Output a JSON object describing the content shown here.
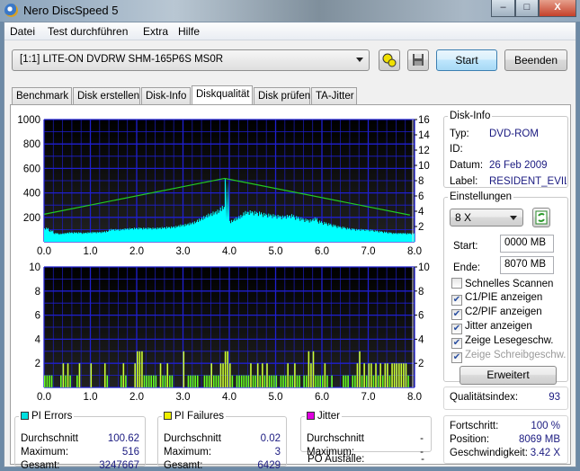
{
  "window": {
    "title": "Nero DiscSpeed 5",
    "minimize": "–",
    "maximize": "□",
    "close": "X"
  },
  "menu": [
    "Datei",
    "Test durchführen",
    "Extra",
    "Hilfe"
  ],
  "toolbar": {
    "drive": "[1:1]  LITE-ON DVDRW SHM-165P6S MS0R",
    "start": "Start",
    "exit": "Beenden"
  },
  "tabs": [
    "Benchmark",
    "Disk erstellen",
    "Disk-Info",
    "Diskqualität",
    "Disk prüfen",
    "TA-Jitter"
  ],
  "active_tab": "Diskqualität",
  "disk_info": {
    "title": "Disk-Info",
    "typ_label": "Typ:",
    "typ": "DVD-ROM",
    "id_label": "ID:",
    "datum_label": "Datum:",
    "datum": "26 Feb 2009",
    "label_label": "Label:",
    "label": "RESIDENT_EVIL"
  },
  "settings": {
    "title": "Einstellungen",
    "speed": "8 X",
    "start_label": "Start:",
    "start": "0000 MB",
    "end_label": "Ende:",
    "end": "8070 MB",
    "checkboxes": [
      {
        "label": "Schnelles Scannen",
        "checked": false,
        "enabled": true
      },
      {
        "label": "C1/PIE anzeigen",
        "checked": true,
        "enabled": true
      },
      {
        "label": "C2/PIF anzeigen",
        "checked": true,
        "enabled": true
      },
      {
        "label": "Jitter anzeigen",
        "checked": true,
        "enabled": true
      },
      {
        "label": "Zeige Lesegeschw.",
        "checked": true,
        "enabled": true
      },
      {
        "label": "Zeige Schreibgeschw.",
        "checked": true,
        "enabled": false
      }
    ],
    "advanced": "Erweitert"
  },
  "quality": {
    "label": "Qualitätsindex:",
    "value": "93"
  },
  "progress": {
    "progress_label": "Fortschritt:",
    "progress": "100 %",
    "position_label": "Position:",
    "position": "8069 MB",
    "speed_label": "Geschwindigkeit:",
    "speed": "3.42 X"
  },
  "stats": {
    "pi_errors": {
      "title": "PI Errors",
      "color": "#00e0e0",
      "avg_label": "Durchschnitt",
      "avg": "100.62",
      "max_label": "Maximum:",
      "max": "516",
      "total_label": "Gesamt:",
      "total": "3247667"
    },
    "pi_failures": {
      "title": "PI Failures",
      "color": "#f0f000",
      "avg_label": "Durchschnitt",
      "avg": "0.02",
      "max_label": "Maximum:",
      "max": "3",
      "total_label": "Gesamt:",
      "total": "6429"
    },
    "jitter": {
      "title": "Jitter",
      "color": "#e000e0",
      "avg_label": "Durchschnitt",
      "avg": "-",
      "max_label": "Maximum:",
      "max": "-",
      "po_label": "PO Ausfälle:",
      "po": "-"
    }
  },
  "chart_data": [
    {
      "type": "area",
      "title": "PI Errors",
      "x_range": [
        0,
        8
      ],
      "ylim": [
        0,
        1000
      ],
      "y2lim": [
        0,
        16
      ],
      "xticks": [
        "0.0",
        "1.0",
        "2.0",
        "3.0",
        "4.0",
        "5.0",
        "6.0",
        "7.0",
        "8.0"
      ],
      "yticks": [
        "1000",
        "800",
        "600",
        "400",
        "200"
      ],
      "y2ticks": [
        "16",
        "14",
        "12",
        "10",
        "8",
        "6",
        "4",
        "2"
      ],
      "pie_step": 0.1,
      "pie": [
        110,
        90,
        70,
        65,
        70,
        75,
        75,
        75,
        72,
        75,
        78,
        78,
        80,
        85,
        100,
        100,
        100,
        105,
        108,
        110,
        112,
        110,
        112,
        110,
        112,
        115,
        118,
        120,
        125,
        135,
        140,
        150,
        160,
        180,
        200,
        220,
        235,
        250,
        280,
        516,
        170,
        190,
        210,
        240,
        245,
        240,
        235,
        225,
        220,
        215,
        210,
        205,
        210,
        215,
        200,
        190,
        180,
        175,
        190,
        165,
        155,
        145,
        135,
        125,
        118,
        110,
        105,
        100,
        100,
        98,
        95,
        90,
        85,
        80,
        75,
        70,
        70,
        70,
        68,
        68
      ],
      "read_speed": [
        [
          0,
          3.6
        ],
        [
          3.9,
          8.3
        ],
        [
          7.9,
          3.5
        ]
      ],
      "colors": {
        "pie": "#00ffff",
        "speed": "#22cc22",
        "grid": "#1f1fd0"
      }
    },
    {
      "type": "bar",
      "title": "PI Failures",
      "x_range": [
        0,
        8
      ],
      "ylim": [
        0,
        10
      ],
      "xticks": [
        "0.0",
        "1.0",
        "2.0",
        "3.0",
        "4.0",
        "5.0",
        "6.0",
        "7.0",
        "8.0"
      ],
      "yticks": [
        "10",
        "8",
        "6",
        "4",
        "2"
      ],
      "y2ticks": [
        "10",
        "8",
        "6",
        "4",
        "2"
      ],
      "pif_step": 0.05,
      "pif": [
        1,
        1,
        1,
        1,
        0,
        0,
        0,
        1,
        2,
        1,
        2,
        1,
        0,
        0,
        1,
        2,
        0,
        0,
        0,
        0,
        2,
        0,
        0,
        0,
        0,
        0,
        2,
        1,
        0,
        0,
        0,
        0,
        0,
        1,
        2,
        1,
        0,
        0,
        0,
        2,
        3,
        3,
        3,
        1,
        1,
        1,
        1,
        1,
        1,
        0,
        2,
        1,
        1,
        2,
        1,
        1,
        0,
        0,
        0,
        0,
        3,
        0,
        1,
        1,
        1,
        1,
        1,
        0,
        0,
        1,
        1,
        1,
        2,
        1,
        1,
        1,
        2,
        2,
        3,
        3,
        2,
        1,
        0,
        1,
        1,
        1,
        1,
        1,
        1,
        2,
        1,
        1,
        2,
        1,
        2,
        1,
        2,
        1,
        1,
        1,
        1,
        0,
        1,
        1,
        1,
        2,
        1,
        1,
        2,
        1,
        1,
        0,
        1,
        1,
        3,
        2,
        3,
        1,
        1,
        1,
        1,
        2,
        1,
        0,
        1,
        0,
        0,
        0,
        0,
        1,
        1,
        1,
        0,
        1,
        1,
        2,
        3,
        1,
        2,
        1,
        2,
        2,
        1,
        2,
        1,
        2,
        1,
        2,
        2,
        1,
        2,
        2,
        2,
        2,
        2,
        2,
        2,
        1
      ],
      "colors": {
        "pif": "#66ff22",
        "pif_hi": "#ccff33",
        "grid": "#1f1fd0"
      }
    }
  ]
}
